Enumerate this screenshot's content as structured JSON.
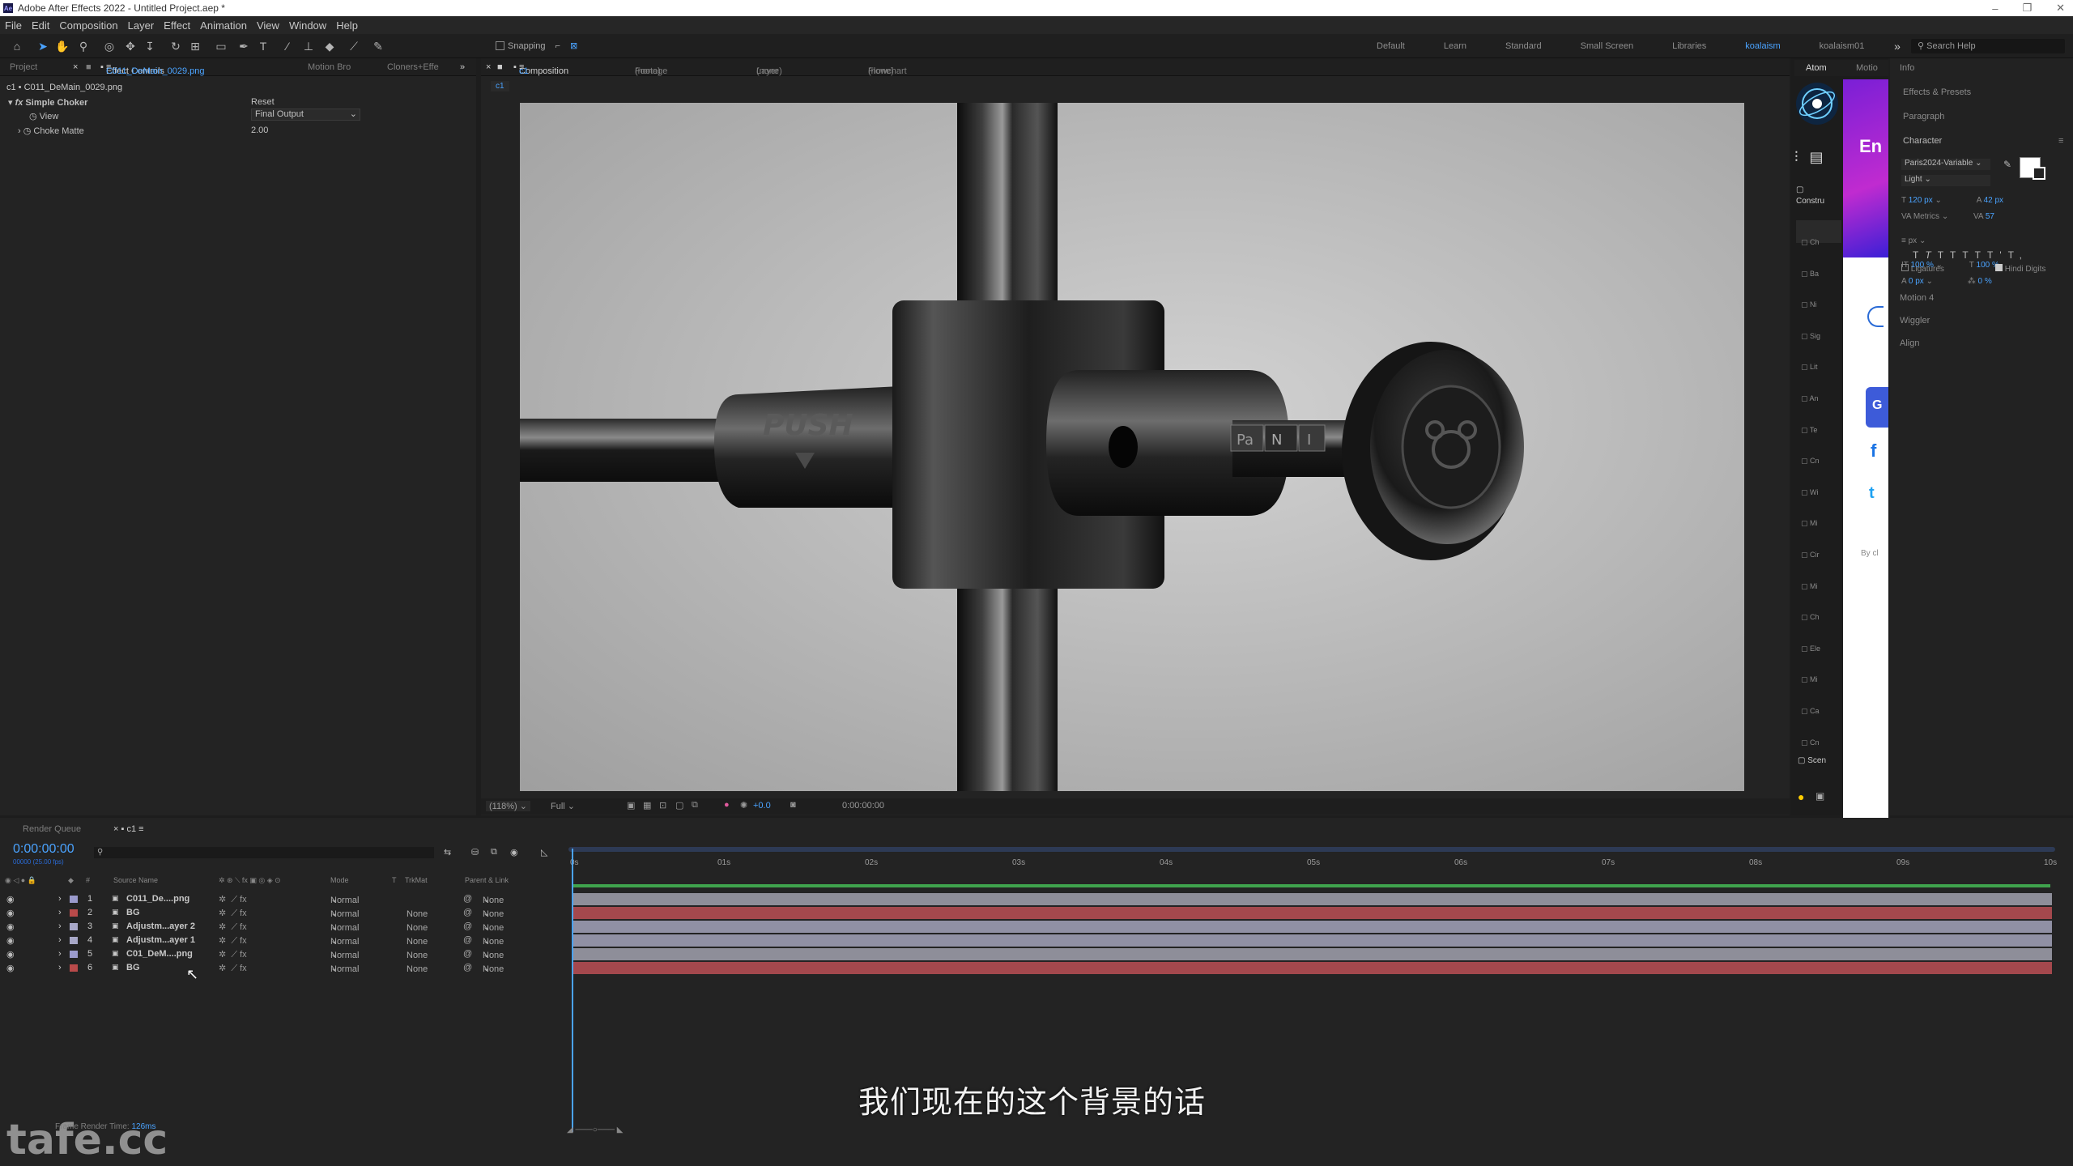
{
  "window": {
    "title": "Adobe After Effects 2022 - Untitled Project.aep *"
  },
  "menu": [
    "File",
    "Edit",
    "Composition",
    "Layer",
    "Effect",
    "Animation",
    "View",
    "Window",
    "Help"
  ],
  "toolbar": {
    "snapping_label": "Snapping",
    "workspaces": [
      "Default",
      "Learn",
      "Standard",
      "Small Screen",
      "Libraries",
      "koalaism",
      "koalaism01"
    ],
    "active_workspace": "koalaism",
    "search_placeholder": "Search Help"
  },
  "left_panel": {
    "tabs": [
      "Project",
      "Effect Controls",
      "C011_DeMain_0029.png",
      "Motion Bro",
      "Cloners+Effe"
    ],
    "breadcrumb": "c1 • C011_DeMain_0029.png",
    "effect_name": "Simple Choker",
    "reset_label": "Reset",
    "params": [
      {
        "label": "View",
        "value": "Final Output"
      },
      {
        "label": "Choke Matte",
        "value": "2.00"
      }
    ]
  },
  "comp_panel": {
    "tabs": [
      "Composition",
      "c1",
      "Footage",
      "(none)",
      "Layer",
      "(none)",
      "Flowchart",
      "(none)"
    ],
    "subtab": "c1",
    "zoom": "(118%)",
    "resolution": "Full",
    "exposure": "+0.0",
    "timecode": "0:00:00:00",
    "scene_labels": {
      "push": "PUSH",
      "tick_pa": "Pa",
      "tick_n": "N",
      "tick_i": "I"
    }
  },
  "extension_panel": {
    "tabs": [
      "Atom",
      "Motio"
    ],
    "construct_label": "Constru",
    "items": [
      "Ch",
      "Ba",
      "Ni",
      "Sig",
      "Lit",
      "An",
      "Te",
      "Cn",
      "Wi",
      "Mi",
      "Cir",
      "Mi",
      "Ch",
      "Ele",
      "Mi",
      "Ca",
      "Cn"
    ],
    "scene_label": "Scen",
    "promo_text": "En",
    "by_text": "By cl",
    "social": {
      "google": "G",
      "facebook": "f",
      "twitter": "t"
    }
  },
  "right_panel": {
    "sections": [
      "Info",
      "Effects & Presets",
      "Paragraph",
      "Character"
    ],
    "character": {
      "font": "Paris2024-Variable",
      "style": "Light",
      "size": "120 px",
      "leading": "42 px",
      "kerning": "Metrics",
      "tracking": "57",
      "stroke_unit": "px",
      "vscale": "100 %",
      "hscale": "100 %",
      "baseline": "0 px",
      "tsume": "0 %",
      "ligatures_label": "Ligatures",
      "hindi_digits_label": "Hindi Digits"
    },
    "extra_panels": [
      "Motion 4",
      "Wiggler",
      "Align"
    ]
  },
  "timeline": {
    "tabs": [
      "Render Queue",
      "c1"
    ],
    "current_time": "0:00:00:00",
    "fps_note": "00000 (25.00 fps)",
    "column_headers": [
      "#",
      "Source Name",
      "Mode",
      "T",
      "TrkMat",
      "Parent & Link"
    ],
    "ruler": [
      "0s",
      "01s",
      "02s",
      "03s",
      "04s",
      "05s",
      "06s",
      "07s",
      "08s",
      "09s",
      "10s"
    ],
    "layers": [
      {
        "num": "1",
        "name": "C011_De....png",
        "mode": "Normal",
        "trkmat": "",
        "parent": "None",
        "color": "#9a9acc",
        "bar": "#8e8e99"
      },
      {
        "num": "2",
        "name": "BG",
        "mode": "Normal",
        "trkmat": "None",
        "parent": "None",
        "color": "#b94a4a",
        "bar": "#a4484d"
      },
      {
        "num": "3",
        "name": "Adjustm...ayer 2",
        "mode": "Normal",
        "trkmat": "None",
        "parent": "None",
        "color": "#a8a8c8",
        "bar": "#9090a4"
      },
      {
        "num": "4",
        "name": "Adjustm...ayer 1",
        "mode": "Normal",
        "trkmat": "None",
        "parent": "None",
        "color": "#a8a8c8",
        "bar": "#9090a4"
      },
      {
        "num": "5",
        "name": "C01_DeM....png",
        "mode": "Normal",
        "trkmat": "None",
        "parent": "None",
        "color": "#9a9acc",
        "bar": "#8e8e99"
      },
      {
        "num": "6",
        "name": "BG",
        "mode": "Normal",
        "trkmat": "None",
        "parent": "None",
        "color": "#b94a4a",
        "bar": "#a4484d"
      }
    ],
    "render_time_label": "Frame Render Time:",
    "render_time_value": "126ms"
  },
  "subtitle": "我们现在的这个背景的话",
  "watermark": "tafe.cc",
  "colors": {
    "accent": "#4aa3ff",
    "timeline_green": "#3fa34d",
    "playhead": "#4aa3ff"
  }
}
